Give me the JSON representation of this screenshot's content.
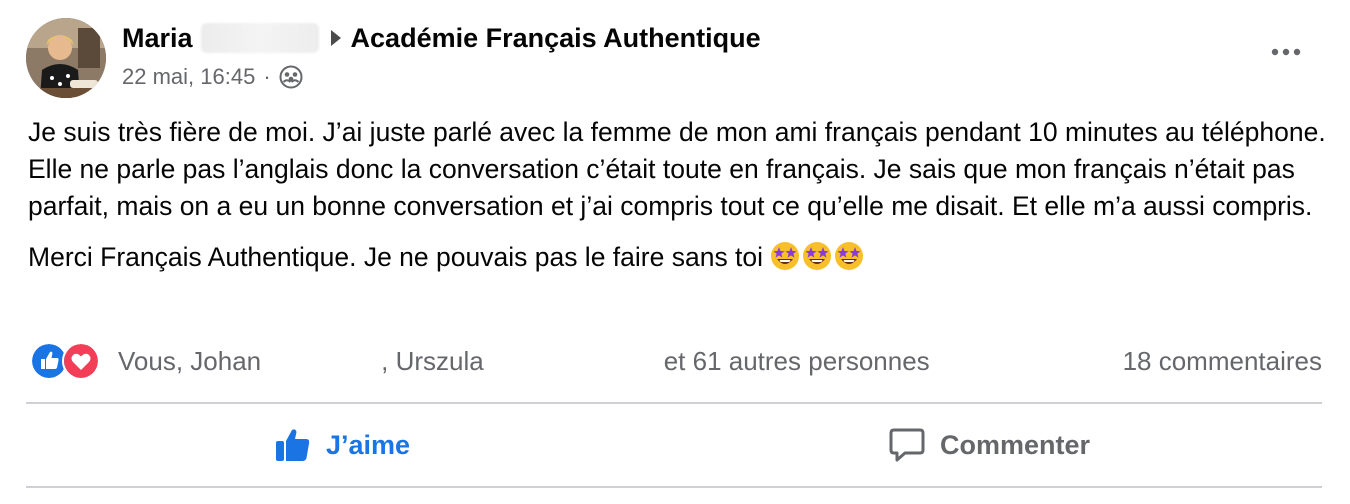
{
  "post": {
    "author_first_name": "Maria",
    "group_name": "Académie Français Authentique",
    "timestamp": "22 mai, 16:45",
    "separator": "·",
    "privacy_icon": "group-icon",
    "paragraph_1": "Je suis très fière de moi. J’ai juste parlé avec la femme de mon ami français pendant 10 minutes au téléphone. Elle ne parle pas l’anglais donc la conversation c’était toute en français. Je sais que mon français n’était pas parfait, mais on a eu un bonne conversation et j’ai compris tout ce qu’elle me disait. Et elle m’a aussi compris.",
    "paragraph_2": "Merci Français Authentique. Je ne pouvais pas le faire sans toi",
    "emojis": [
      "star-struck-icon",
      "star-struck-icon",
      "star-struck-icon"
    ]
  },
  "reactions": {
    "icons": [
      "like-icon",
      "love-icon"
    ],
    "reactor_1": "Vous, Johan",
    "reactor_2": ", Urszula",
    "others": "et 61 autres personnes",
    "comments_count": "18 commentaires"
  },
  "actions": {
    "like_label": "J’aime",
    "comment_label": "Commenter"
  },
  "colors": {
    "accent": "#1b74e4",
    "secondary_text": "#65676b",
    "love_red": "#f33e58",
    "divider": "#ced0d4"
  }
}
